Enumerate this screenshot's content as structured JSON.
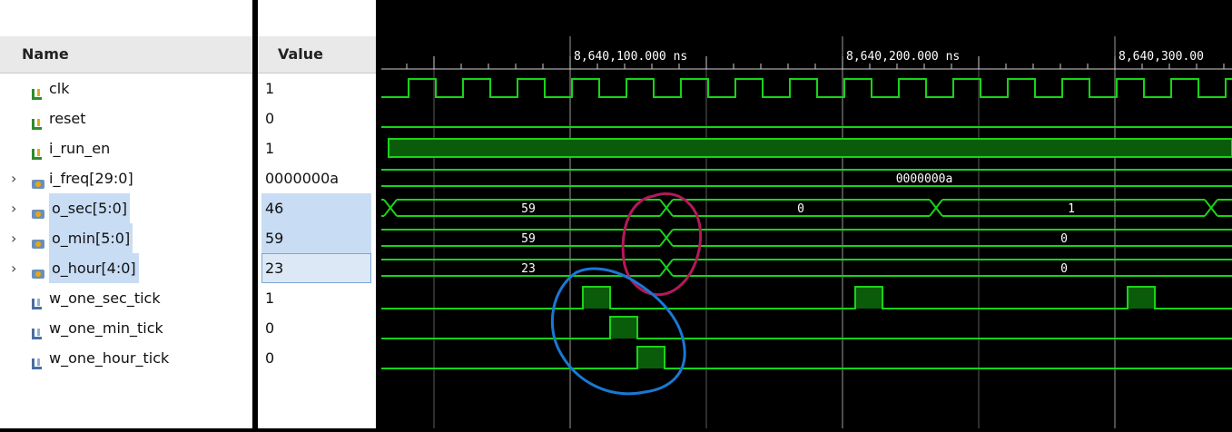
{
  "columns": {
    "name_header": "Name",
    "value_header": "Value"
  },
  "signals": [
    {
      "name": "clk",
      "value": "1",
      "kind": "bit",
      "expandable": false,
      "selected": false
    },
    {
      "name": "reset",
      "value": "0",
      "kind": "bit",
      "expandable": false,
      "selected": false
    },
    {
      "name": "i_run_en",
      "value": "1",
      "kind": "bit",
      "expandable": false,
      "selected": false
    },
    {
      "name": "i_freq[29:0]",
      "value": "0000000a",
      "kind": "bus",
      "expandable": true,
      "selected": false
    },
    {
      "name": "o_sec[5:0]",
      "value": "46",
      "kind": "bus",
      "expandable": true,
      "selected": true
    },
    {
      "name": "o_min[5:0]",
      "value": "59",
      "kind": "bus",
      "expandable": true,
      "selected": true
    },
    {
      "name": "o_hour[4:0]",
      "value": "23",
      "kind": "bus",
      "expandable": true,
      "selected": true
    },
    {
      "name": "w_one_sec_tick",
      "value": "1",
      "kind": "wire",
      "expandable": false,
      "selected": false
    },
    {
      "name": "w_one_min_tick",
      "value": "0",
      "kind": "wire",
      "expandable": false,
      "selected": false
    },
    {
      "name": "w_one_hour_tick",
      "value": "0",
      "kind": "wire",
      "expandable": false,
      "selected": false
    }
  ],
  "timeline": {
    "markers": [
      "8,640,100.000 ns",
      "8,640,200.000 ns",
      "8,640,300.00"
    ]
  },
  "waveform_labels": {
    "i_freq": "0000000a",
    "o_sec": [
      "59",
      "0",
      "1"
    ],
    "o_min": [
      "59",
      "0"
    ],
    "o_hour": [
      "23",
      "0"
    ]
  },
  "colors": {
    "wave": "#17d417",
    "bus_fill": "#0a5c0a",
    "annotation_red": "#b4195a",
    "annotation_blue": "#1a78d4"
  },
  "icons": {
    "bit": "bit-signal-icon",
    "bus": "bus-signal-icon",
    "wire": "wire-signal-icon"
  }
}
